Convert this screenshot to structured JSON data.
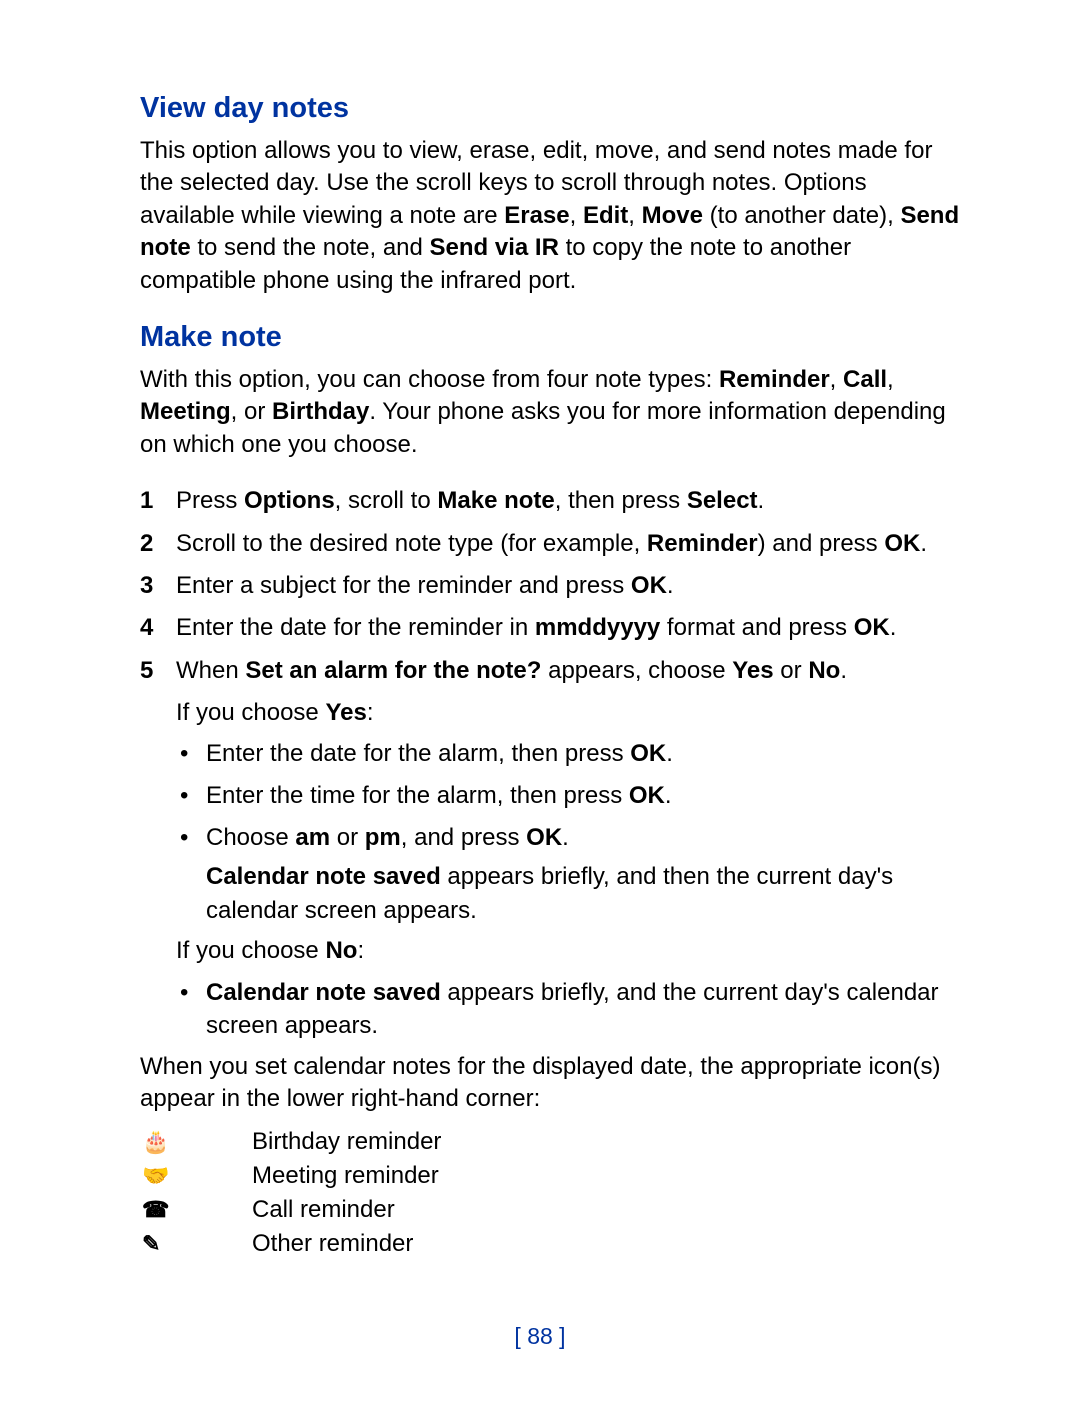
{
  "sections": {
    "view_day_notes": {
      "heading": "View day notes",
      "para_parts": [
        "This option allows you to view, erase, edit, move, and send notes made for the selected day. Use the scroll keys to scroll through notes. Options available while viewing a note are ",
        "Erase",
        ", ",
        "Edit",
        ", ",
        "Move",
        " (to another date), ",
        "Send note",
        " to send the note, and ",
        "Send via IR",
        " to copy the note to another compatible phone using the infrared port."
      ]
    },
    "make_note": {
      "heading": "Make note",
      "intro_parts": [
        "With this option, you can choose from four note types: ",
        "Reminder",
        ", ",
        "Call",
        ", ",
        "Meeting",
        ", or ",
        "Birthday",
        ". Your phone asks you for more information depending on which one you choose."
      ],
      "steps": {
        "s1": [
          "Press ",
          "Options",
          ", scroll to ",
          "Make note",
          ", then press ",
          "Select",
          "."
        ],
        "s2": [
          "Scroll to the desired note type (for example, ",
          "Reminder",
          ") and press ",
          "OK",
          "."
        ],
        "s3": [
          "Enter a subject for the reminder and press ",
          "OK",
          "."
        ],
        "s4": [
          "Enter the date for the reminder in ",
          "mmddyyyy",
          " format and press ",
          "OK",
          "."
        ],
        "s5": [
          "When ",
          "Set an alarm for the note?",
          " appears, choose ",
          "Yes",
          " or ",
          "No",
          "."
        ]
      },
      "yes_block": {
        "intro": [
          "If you choose ",
          "Yes",
          ":"
        ],
        "bullets": {
          "b1": [
            "Enter the date for the alarm, then press ",
            "OK",
            "."
          ],
          "b2": [
            "Enter the time for the alarm, then press ",
            "OK",
            "."
          ],
          "b3": [
            "Choose ",
            "am",
            " or ",
            "pm",
            ", and press ",
            "OK",
            "."
          ]
        },
        "after": [
          "Calendar note saved",
          " appears briefly, and then the current day's calendar screen appears."
        ]
      },
      "no_block": {
        "intro": [
          "If you choose ",
          "No",
          ":"
        ],
        "bullet": [
          "Calendar note saved",
          " appears briefly, and the current day's calendar screen appears."
        ]
      },
      "icons_intro": "When you set calendar notes for the displayed date, the appropriate icon(s) appear in the lower right-hand corner:",
      "icons": {
        "birthday": {
          "glyph": "🎂",
          "label": "Birthday reminder"
        },
        "meeting": {
          "glyph": "🤝",
          "label": "Meeting reminder"
        },
        "call": {
          "glyph": "☎",
          "label": "Call reminder"
        },
        "other": {
          "glyph": "✎",
          "label": "Other reminder"
        }
      }
    }
  },
  "page_number": "[ 88 ]"
}
